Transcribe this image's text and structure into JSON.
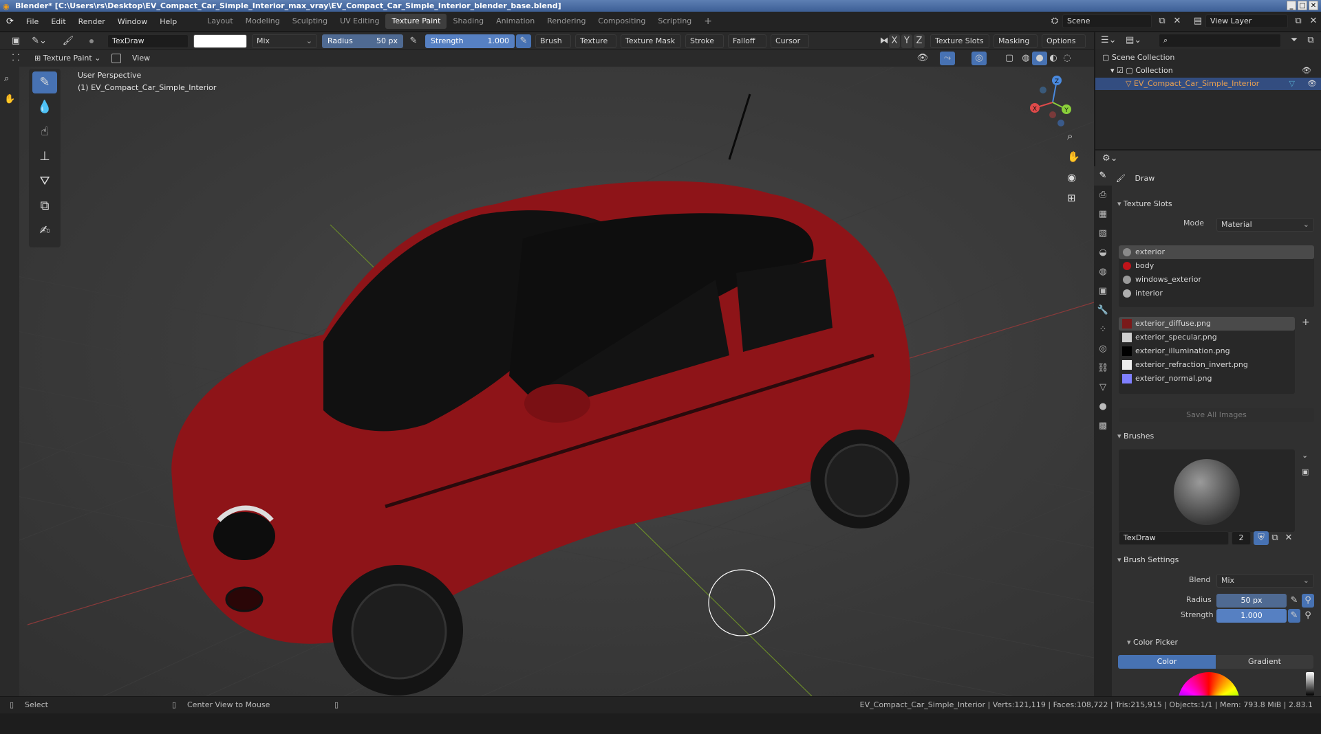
{
  "window": {
    "title": "Blender* [C:\\Users\\rs\\Desktop\\EV_Compact_Car_Simple_Interior_max_vray\\EV_Compact_Car_Simple_Interior_blender_base.blend]"
  },
  "menu": [
    "File",
    "Edit",
    "Render",
    "Window",
    "Help"
  ],
  "workspaces": [
    "Layout",
    "Modeling",
    "Sculpting",
    "UV Editing",
    "Texture Paint",
    "Shading",
    "Animation",
    "Rendering",
    "Compositing",
    "Scripting"
  ],
  "active_workspace": "Texture Paint",
  "scene": {
    "name": "Scene",
    "view_layer": "View Layer"
  },
  "tool_header": {
    "brush_name": "TexDraw",
    "blend": "Mix",
    "radius_label": "Radius",
    "radius_value": "50 px",
    "strength_label": "Strength",
    "strength_value": "1.000",
    "menus": [
      "Brush",
      "Texture",
      "Texture Mask",
      "Stroke",
      "Falloff",
      "Cursor"
    ],
    "axes": [
      "X",
      "Y",
      "Z"
    ],
    "right_menus": [
      "Texture Slots",
      "Masking",
      "Options"
    ]
  },
  "sub_header": {
    "mode": "Texture Paint",
    "view": "View"
  },
  "viewport": {
    "perspective": "User Perspective",
    "object": "(1) EV_Compact_Car_Simple_Interior",
    "gizmo_axes": [
      "X",
      "Y",
      "Z"
    ]
  },
  "outliner": {
    "scene_collection": "Scene Collection",
    "collection": "Collection",
    "object": "EV_Compact_Car_Simple_Interior"
  },
  "properties": {
    "tool_name": "Draw",
    "texture_slots_title": "Texture Slots",
    "mode_label": "Mode",
    "mode_value": "Material",
    "materials": [
      {
        "name": "exterior",
        "color": "#8a8a8a"
      },
      {
        "name": "body",
        "color": "#c0141a"
      },
      {
        "name": "windows_exterior",
        "color": "#9a9a9a"
      },
      {
        "name": "interior",
        "color": "#b0b0b0"
      }
    ],
    "images": [
      {
        "name": "exterior_diffuse.png",
        "color": "#7a1a1a"
      },
      {
        "name": "exterior_specular.png",
        "color": "#cfcfcf"
      },
      {
        "name": "exterior_illumination.png",
        "color": "#000000"
      },
      {
        "name": "exterior_refraction_invert.png",
        "color": "#eeeeee"
      },
      {
        "name": "exterior_normal.png",
        "color": "#8080ff"
      }
    ],
    "save_all": "Save All Images",
    "brushes_title": "Brushes",
    "brush_name": "TexDraw",
    "brush_users": "2",
    "brush_settings_title": "Brush Settings",
    "blend_label": "Blend",
    "blend_value": "Mix",
    "radius_label": "Radius",
    "radius_value": "50 px",
    "strength_label": "Strength",
    "strength_value": "1.000",
    "color_picker_title": "Color Picker",
    "color_tab": "Color",
    "gradient_tab": "Gradient"
  },
  "status": {
    "select": "Select",
    "center": "Center View to Mouse",
    "info": "EV_Compact_Car_Simple_Interior | Verts:121,119 | Faces:108,722 | Tris:215,915 | Objects:1/1 | Mem: 793.8 MiB | 2.83.1"
  },
  "colors": {
    "accent": "#4772b3",
    "car_body": "#8e1418"
  }
}
